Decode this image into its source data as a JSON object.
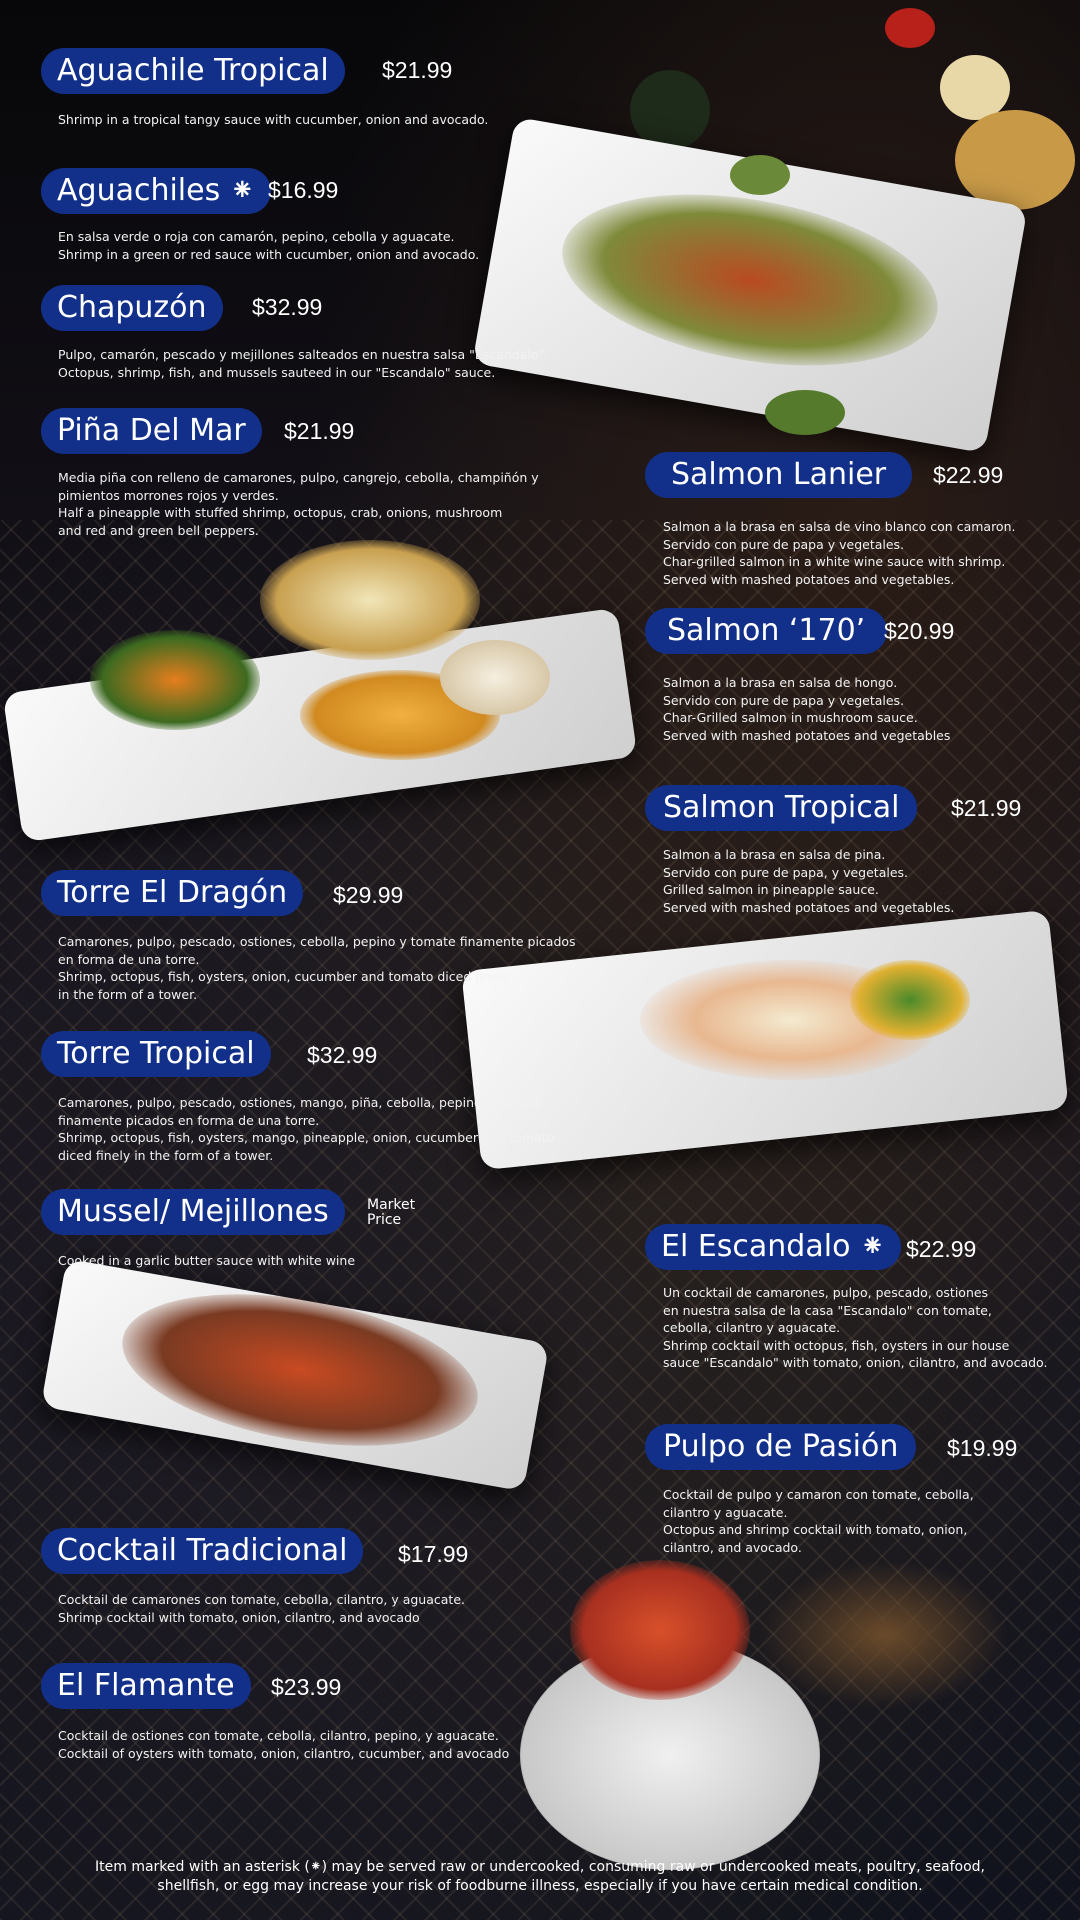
{
  "items": [
    {
      "name": "Aguachile Tropical",
      "price": "$21.99",
      "desc": "Shrimp in a tropical tangy sauce with cucumber, onion and avocado."
    },
    {
      "name": "Aguachiles ⁕",
      "price": "$16.99",
      "desc": "En salsa verde o roja con camarón, pepino, cebolla y aguacate.\nShrimp in a green or red sauce with cucumber, onion and avocado."
    },
    {
      "name": "Chapuzón",
      "price": "$32.99",
      "desc": "Pulpo, camarón, pescado y mejillones salteados en nuestra salsa \"Escándalo\".\nOctopus, shrimp, fish, and mussels sauteed in our \"Escandalo\" sauce."
    },
    {
      "name": "Piña Del Mar",
      "price": "$21.99",
      "desc": "Media piña con relleno de camarones, pulpo, cangrejo, cebolla, champiñón y\npimientos morrones rojos y verdes.\nHalf a pineapple with stuffed shrimp, octopus, crab, onions, mushroom\nand red and green bell peppers."
    },
    {
      "name": "Salmon Lanier",
      "price": "$22.99",
      "desc": "Salmon a la brasa en salsa de vino blanco con camaron.\nServido con pure de papa y vegetales.\nChar-grilled salmon in a white wine sauce with shrimp.\nServed with mashed potatoes and vegetables."
    },
    {
      "name": "Salmon ‘170’",
      "price": "$20.99",
      "desc": "Salmon a la brasa en salsa de hongo.\nServido con pure de papa y vegetales.\n Char-Grilled salmon in mushroom sauce.\nServed with mashed potatoes and vegetables"
    },
    {
      "name": "Salmon Tropical",
      "price": "$21.99",
      "desc": "Salmon a la brasa en salsa de pina.\nServido con pure de papa, y vegetales.\nGrilled salmon in pineapple sauce.\nServed with mashed potatoes and vegetables."
    },
    {
      "name": "Torre El Dragón",
      "price": "$29.99",
      "desc": "Camarones, pulpo, pescado, ostiones, cebolla, pepino y tomate finamente picados\nen forma de una torre.\nShrimp, octopus, fish, oysters, onion, cucumber and tomato diced finely\nin the form of a tower."
    },
    {
      "name": "Torre Tropical",
      "price": "$32.99",
      "desc": "Camarones, pulpo, pescado, ostiones, mango, piña, cebolla, pepino y tomate\nfinamente picados en forma de una torre.\nShrimp, octopus, fish, oysters, mango, pineapple, onion, cucumber and tomato\n diced finely in the form of a tower."
    },
    {
      "name": "Mussel/ Mejillones",
      "price": "Market\nPrice",
      "desc": "Cooked in a garlic butter sauce with white wine"
    },
    {
      "name": "El Escandalo ⁕",
      "price": "$22.99",
      "desc": "Un cocktail de camarones, pulpo, pescado, ostiones\nen nuestra salsa de la casa \"Escandalo\" con tomate,\ncebolla, cilantro y aguacate.\nShrimp cocktail with octopus, fish, oysters in our house\nsauce \"Escandalo\" with tomato, onion, cilantro, and avocado."
    },
    {
      "name": "Pulpo de Pasión",
      "price": "$19.99",
      "desc": "Cocktail de pulpo y camaron con tomate, cebolla,\ncilantro y aguacate.\nOctopus and shrimp cocktail with tomato, onion,\ncilantro, and avocado."
    },
    {
      "name": "Cocktail Tradicional",
      "price": "$17.99",
      "desc": "Cocktail de camarones con tomate, cebolla, cilantro, y aguacate.\nShrimp cocktail with tomato, onion, cilantro, and avocado"
    },
    {
      "name": "El Flamante",
      "price": "$23.99",
      "desc": "Cocktail de ostiones con tomate, cebolla, cilantro, pepino, y aguacate.\nCocktail of oysters with tomato, onion, cilantro, cucumber, and avocado"
    }
  ],
  "footer": "Item marked with an asterisk (⁕) may be served raw or undercooked, consuming raw or undercooked meats, poultry, seafood,\nshellfish, or egg may increase your risk of foodburne illness, especially if you have certain medical condition.",
  "colors": {
    "pill": "#12308a",
    "background": "#0b0b10",
    "text": "#ffffff"
  }
}
